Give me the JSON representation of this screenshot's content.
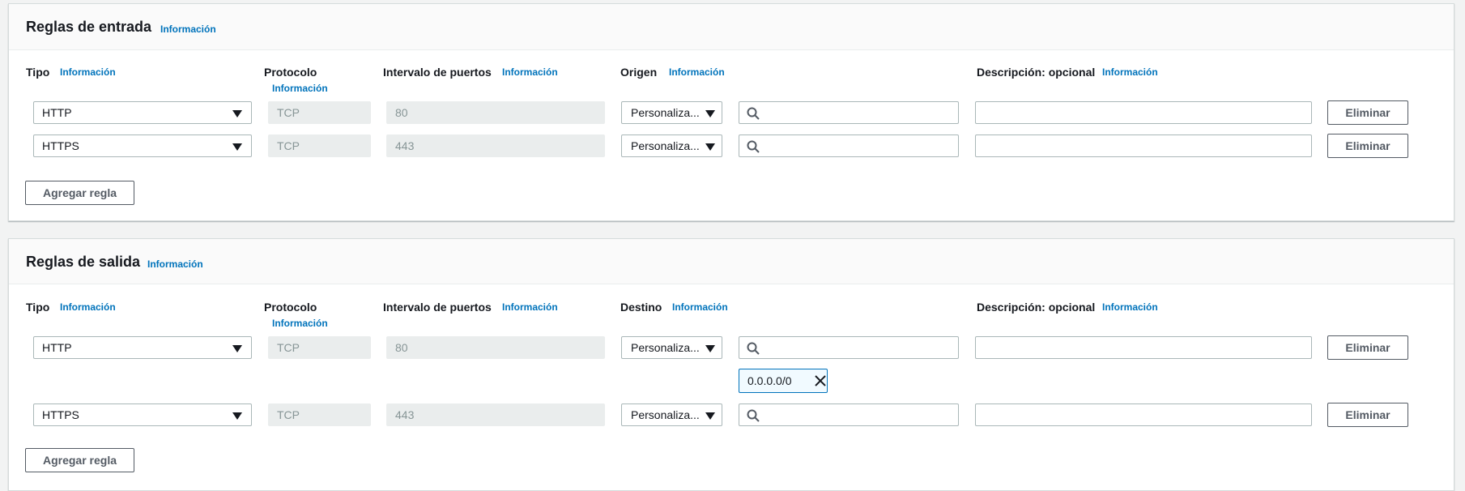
{
  "inbound": {
    "title": "Reglas de entrada",
    "info": "Información",
    "columns": {
      "type": "Tipo",
      "protocol": "Protocolo",
      "port_range": "Intervalo de puertos",
      "origin": "Origen",
      "description": "Descripción: opcional",
      "info": "Información"
    },
    "rules": [
      {
        "type": "HTTP",
        "protocol": "TCP",
        "port": "80",
        "origin_mode": "Personaliza...",
        "search_value": "",
        "description": "",
        "remove": "Eliminar"
      },
      {
        "type": "HTTPS",
        "protocol": "TCP",
        "port": "443",
        "origin_mode": "Personaliza...",
        "search_value": "",
        "description": "",
        "remove": "Eliminar"
      }
    ],
    "add_rule": "Agregar regla"
  },
  "outbound": {
    "title": "Reglas de salida",
    "info": "Información",
    "columns": {
      "type": "Tipo",
      "protocol": "Protocolo",
      "port_range": "Intervalo de puertos",
      "destination": "Destino",
      "description": "Descripción: opcional",
      "info": "Información"
    },
    "rules": [
      {
        "type": "HTTP",
        "protocol": "TCP",
        "port": "80",
        "dest_mode": "Personaliza...",
        "search_value": "",
        "token": "0.0.0.0/0",
        "description": "",
        "remove": "Eliminar"
      },
      {
        "type": "HTTPS",
        "protocol": "TCP",
        "port": "443",
        "dest_mode": "Personaliza...",
        "search_value": "",
        "description": "",
        "remove": "Eliminar"
      }
    ],
    "add_rule": "Agregar regla"
  },
  "colors": {
    "link": "#0073bb",
    "background": "#f2f3f3",
    "disabled_field": "#eaeded",
    "token_border": "#0073bb",
    "token_bg": "#f1faff"
  },
  "icons": {
    "search": "search-icon",
    "caret": "caret-down-icon",
    "close": "close-icon"
  }
}
